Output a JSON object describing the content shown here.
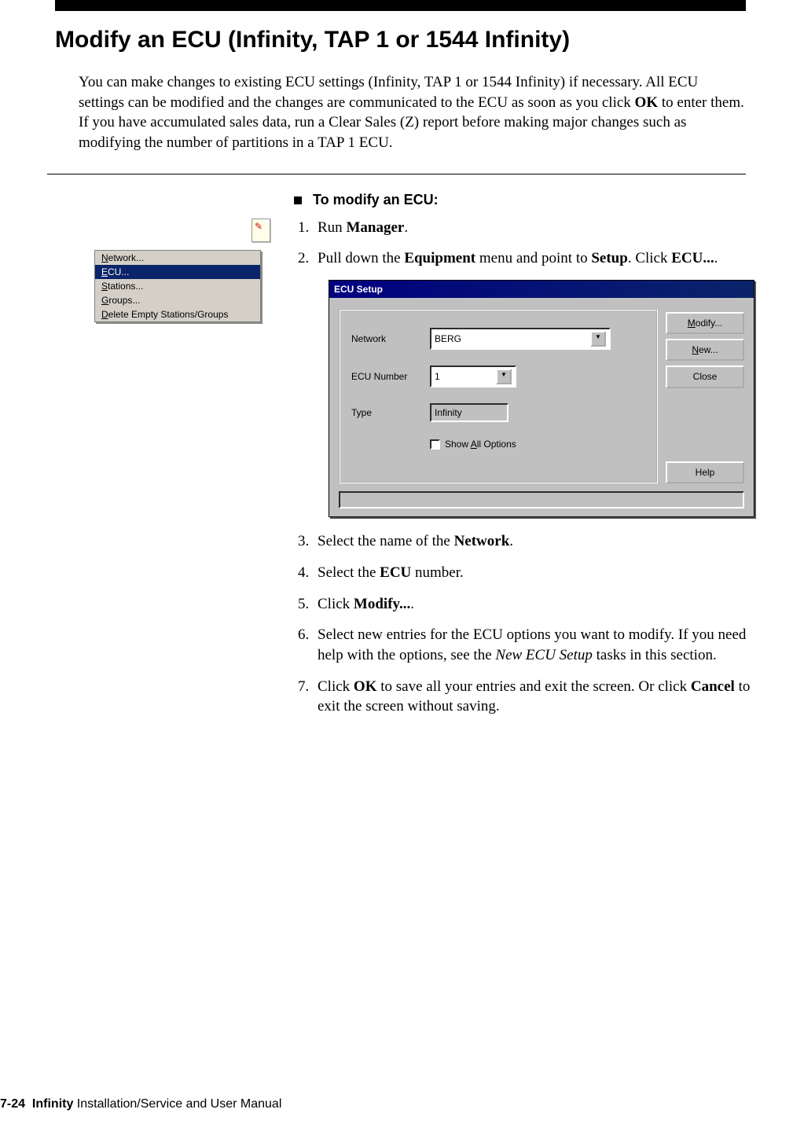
{
  "header": {
    "title": "Modify an ECU (Infinity, TAP 1 or 1544 Infinity)"
  },
  "intro": {
    "p1a": "You can make changes to existing ECU settings (Infinity, TAP 1 or 1544 Infinity) if necessary. All ECU settings can be modified and the changes are communicated to the ECU as soon as you click ",
    "p1b": "OK",
    "p1c": " to enter them. If you have accumulated sales data, run a Clear Sales (Z) report before making major changes such as modifying the number of partitions in a TAP 1 ECU."
  },
  "menu": {
    "network_u": "N",
    "network_rest": "etwork...",
    "ecu_u": "E",
    "ecu_rest": "CU...",
    "stations_u": "S",
    "stations_rest": "tations...",
    "groups_u": "G",
    "groups_rest": "roups...",
    "delete_u": "D",
    "delete_rest": "elete Empty Stations/Groups"
  },
  "procedure": {
    "heading": "To modify an ECU:",
    "s1a": "Run ",
    "s1b": "Manager",
    "s1c": ".",
    "s2a": "Pull down the ",
    "s2b": "Equipment",
    "s2c": " menu and point to ",
    "s2d": "Setup",
    "s2e": ". Click ",
    "s2f": "ECU...",
    "s2g": ".",
    "s3a": "Select the name of the ",
    "s3b": "Network",
    "s3c": ".",
    "s4a": "Select the ",
    "s4b": "ECU",
    "s4c": " number.",
    "s5a": "Click ",
    "s5b": "Modify...",
    "s5c": ".",
    "s6a": "Select new entries for the ECU options you want to modify. If you need help with the options, see the ",
    "s6b": "New ECU Setup",
    "s6c": " tasks in this section.",
    "s7a": "Click ",
    "s7b": "OK",
    "s7c": " to save all your entries and exit the screen. Or click ",
    "s7d": "Cancel",
    "s7e": " to exit the screen without saving."
  },
  "dialog": {
    "title": "ECU Setup",
    "network_label": "Network",
    "network_value": "BERG",
    "ecu_label": "ECU Number",
    "ecu_value": "1",
    "type_label": "Type",
    "type_value": "Infinity",
    "showall_pre": "Show ",
    "showall_u": "A",
    "showall_post": "ll Options",
    "modify_u": "M",
    "modify_rest": "odify...",
    "new_u": "N",
    "new_rest": "ew...",
    "close": "Close",
    "help": "Help"
  },
  "footer": {
    "page": "7-24",
    "b": "Infinity",
    "rest": " Installation/Service and User Manual"
  }
}
